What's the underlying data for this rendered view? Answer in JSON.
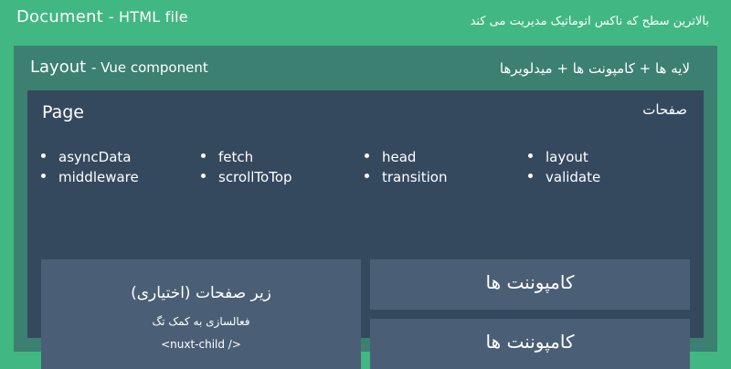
{
  "document": {
    "title": "Document",
    "subtitle": "- HTML file",
    "note": "بالاترین سطح که ناکس اتوماتیک مدیریت می کند"
  },
  "layout": {
    "title": "Layout",
    "subtitle": "- Vue component",
    "note": "لایه ها + کامپونت ها + میدلویرها"
  },
  "page": {
    "title": "Page",
    "note": "صفحات",
    "methods": [
      "asyncData",
      "fetch",
      "head",
      "layout",
      "middleware",
      "scrollToTop",
      "transition",
      "validate"
    ],
    "child": {
      "title": "زیر صفحات (اختیاری)",
      "description": "فعالسازی به کمک تگ",
      "tag": "<nuxt-child />"
    },
    "components": [
      "کامپوننت ها",
      "کامپوننت ها"
    ]
  },
  "colors": {
    "document_bg": "#41b883",
    "layout_bg": "#3b8070",
    "page_bg": "#35495e",
    "card_bg": "#4a5f75"
  }
}
